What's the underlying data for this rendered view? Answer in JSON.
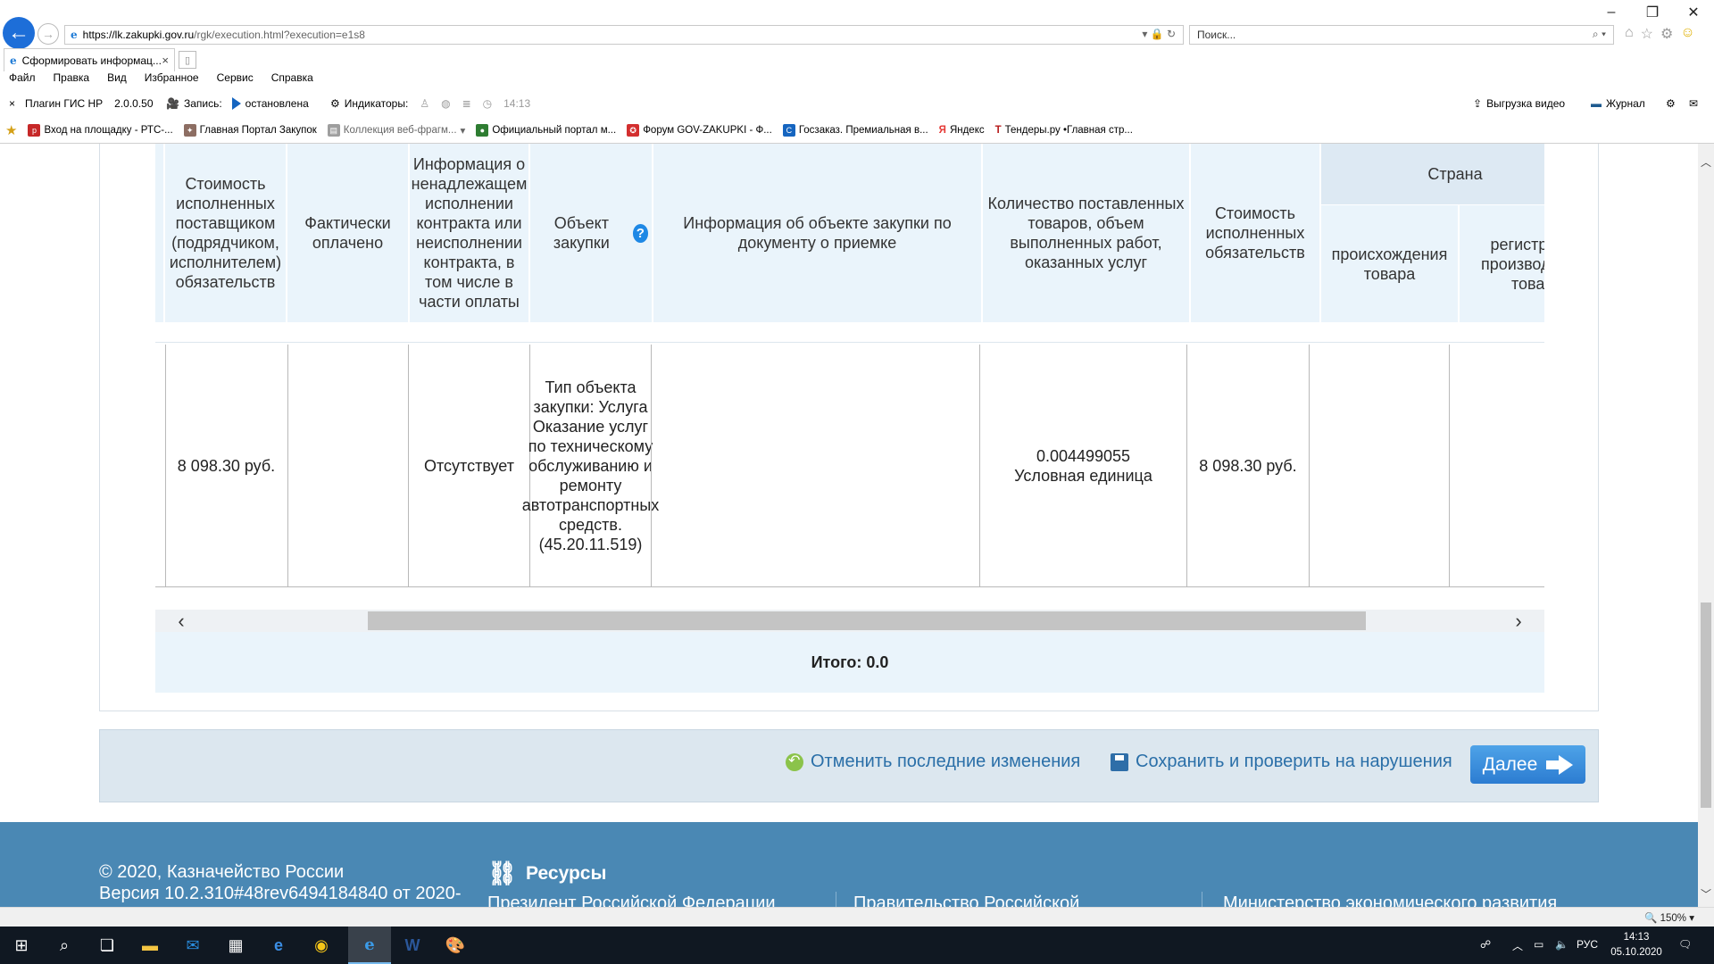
{
  "browser": {
    "url_host": "https://lk.zakupki.gov.ru",
    "url_path": "/rgk/execution.html?execution=e1s8",
    "search_placeholder": "Поиск...",
    "tab_title": "Сформировать информац...",
    "tab_close": "×",
    "menu": [
      "Файл",
      "Правка",
      "Вид",
      "Избранное",
      "Сервис",
      "Справка"
    ],
    "plugin": {
      "close": "×",
      "name": "Плагин ГИС НР",
      "version": "2.0.0.50",
      "record_label": "Запись:",
      "record_status": "остановлена",
      "indicators_label": "Индикаторы:",
      "time": "14:13",
      "export_video": "Выгрузка видео",
      "journal": "Журнал"
    },
    "favorites": [
      {
        "label": "Вход на площадку - РТС-...",
        "icon": "rts-icon",
        "color": "#c62828"
      },
      {
        "label": "Главная Портал Закупок",
        "icon": "emblem-icon",
        "color": "#8d6e63"
      },
      {
        "label": "Коллекция веб-фрагм...",
        "icon": "webslice-icon",
        "color": "#9e9e9e"
      },
      {
        "label": "Официальный портал м...",
        "icon": "portal-icon",
        "color": "#2e7d32"
      },
      {
        "label": "Форум GOV-ZAKUPKI - Ф...",
        "icon": "forum-icon",
        "color": "#d32f2f"
      },
      {
        "label": "Госзаказ. Премиальная в...",
        "icon": "goszakaz-icon",
        "color": "#1565c0"
      },
      {
        "label": "Яндекс",
        "icon": "yandex-icon",
        "color": "#e53935"
      },
      {
        "label": "Тендеры.ру •Главная стр...",
        "icon": "tenders-icon",
        "color": "#b71c1c"
      }
    ]
  },
  "table": {
    "headers": {
      "cost_executed_supplier": "Стоимость исполненных поставщиком (подрядчиком, исполнителем) обязательств",
      "actually_paid": "Фактически оплачено",
      "improper_info": "Информация о ненадлежащем исполнении контракта или неисполнении контракта, в том числе в части оплаты",
      "object": "Объект закупки",
      "object_info": "Информация об объекте закупки по документу о приемке",
      "quantity": "Количество поставленных товаров, объем выполненных работ, оказанных услуг",
      "cost_executed": "Стоимость исполненных обязательств",
      "country": "Страна",
      "country_origin": "происхождения товара",
      "country_reg": "регистрации производителя товара"
    },
    "row": {
      "cost_executed_supplier": "8 098.30 руб.",
      "actually_paid": "",
      "improper_info": "Отсутствует",
      "object": "Тип объекта закупки: Услуга Оказание услуг по техническому обслуживанию и ремонту автотранспортных средств. (45.20.11.519)",
      "object_info": "",
      "quantity": "0.004499055 Условная единица",
      "cost_executed": "8 098.30 руб.",
      "country_origin": "",
      "country_reg": ""
    },
    "total": "Итого: 0.0"
  },
  "actions": {
    "undo": "Отменить последние изменения",
    "save": "Сохранить и проверить на нарушения",
    "next": "Далее"
  },
  "footer": {
    "copyright": "© 2020, Казначейство России",
    "version": "Версия 10.2.310#48rev6494184840 от 2020-",
    "resources": "Ресурсы",
    "links": [
      "Президент Российской Федерации",
      "Правительство Российской",
      "Министерство экономического развития"
    ]
  },
  "status": {
    "zoom": "150%"
  },
  "taskbar": {
    "lang": "РУС",
    "time": "14:13",
    "date": "05.10.2020"
  }
}
